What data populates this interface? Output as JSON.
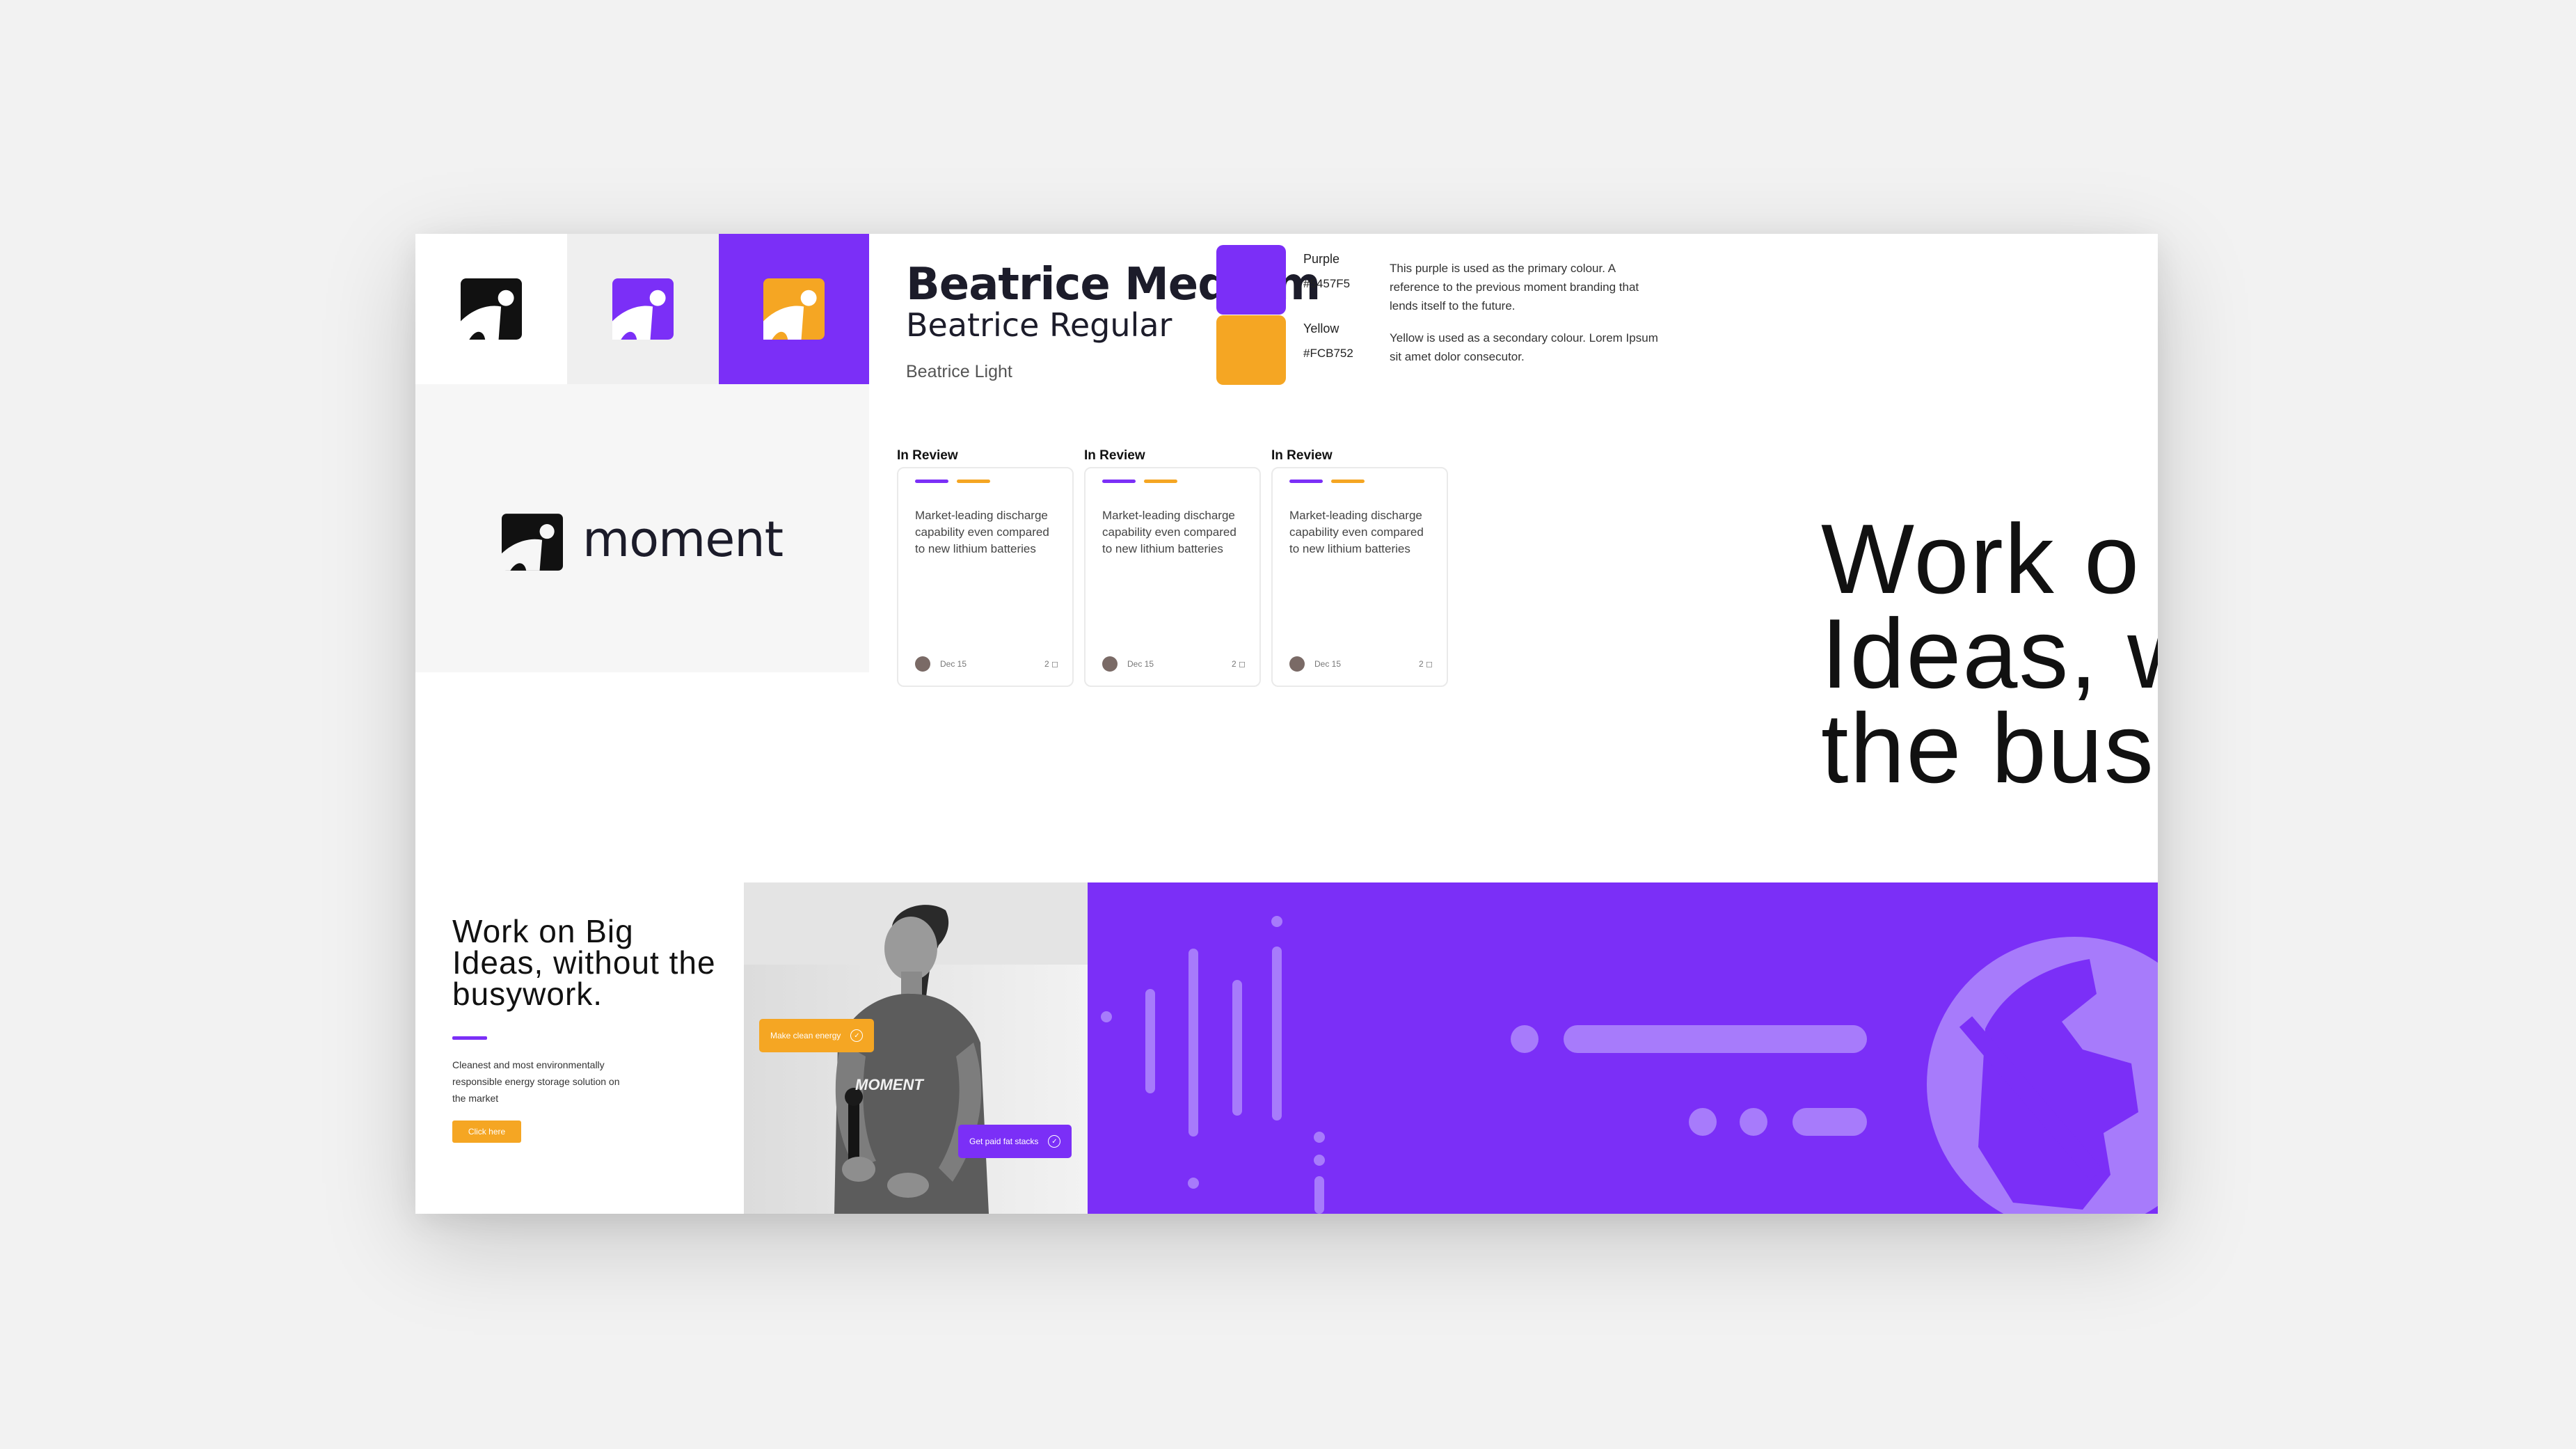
{
  "colors": {
    "purple": "#7B2FF7",
    "yellow": "#F5A623",
    "black": "#111111"
  },
  "icons": [
    "moment-logo-icon",
    "check-circle-icon",
    "globe-icon"
  ],
  "typography": {
    "medium": "Beatrice Medium",
    "regular": "Beatrice Regular",
    "light": "Beatrice Light"
  },
  "swatches": [
    {
      "name": "Purple",
      "hex": "#5457F5",
      "description": "This purple is used as the primary colour. A reference to the previous moment branding that lends itself to the future."
    },
    {
      "name": "Yellow",
      "hex": "#FCB752",
      "description": "Yellow is used as a secondary colour. Lorem Ipsum sit amet dolor consecutor."
    }
  ],
  "brand": {
    "wordmark": "moment",
    "shirt_text": "MOMENT"
  },
  "kanban": [
    {
      "title": "In Review",
      "text": "even compared to new lithium batteries",
      "highlight": "Market-leading discharge capability",
      "date": "Dec 15",
      "count": "2"
    },
    {
      "title": "In Review",
      "text": "Market-leading discharge capability even compared to new lithium batteries",
      "highlight": "",
      "date": "Dec 15",
      "count": "2"
    },
    {
      "title": "In Review",
      "text": "Market-leading discharge capability even compared to new lithium batteries",
      "highlight": "",
      "date": "Dec 15",
      "count": "2"
    }
  ],
  "big_heading": [
    "Work o",
    "Ideas, w",
    "the bus"
  ],
  "small_heading": "Work on Big Ideas, without the busywork.",
  "small_body": "Cleanest and most environmentally responsible energy storage solution on the market",
  "cta_label": "Click here",
  "chips": {
    "orange": "Make clean energy",
    "purple": "Get paid fat stacks"
  }
}
